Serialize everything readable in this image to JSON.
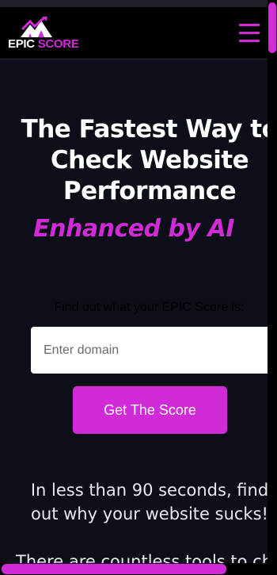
{
  "header": {
    "logo_word_epic": "EPIC",
    "logo_word_score": "SCORE",
    "menu_icon": "hamburger-menu-icon"
  },
  "hero": {
    "title": "The Fastest Way to Check Website Performance",
    "subtitle": "Enhanced by AI"
  },
  "form": {
    "prompt": "Find out what your EPIC Score is:",
    "domain_placeholder": "Enter domain",
    "domain_value": "",
    "submit_label": "Get The Score"
  },
  "body": {
    "line1": "In less than 90 seconds, find out why your website sucks!",
    "line2": "There are countless tools to check"
  },
  "colors": {
    "accent": "#d02bd6",
    "background": "#0d0f18",
    "header": "#000000",
    "text": "#ffffff"
  }
}
